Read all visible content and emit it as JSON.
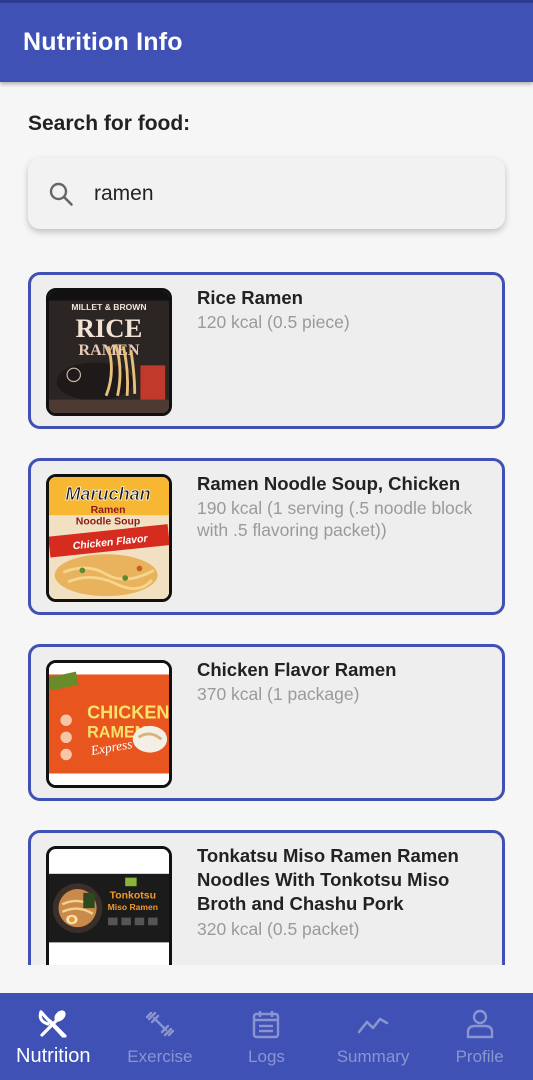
{
  "app_bar": {
    "title": "Nutrition Info"
  },
  "search": {
    "label": "Search for food:",
    "value": "ramen"
  },
  "results": [
    {
      "name": "Rice Ramen",
      "kcal": "120 kcal (0.5 piece)"
    },
    {
      "name": "Ramen Noodle Soup, Chicken",
      "kcal": "190 kcal (1 serving (.5 noodle block with .5 flavoring packet))"
    },
    {
      "name": "Chicken Flavor Ramen",
      "kcal": "370 kcal (1 package)"
    },
    {
      "name": "Tonkatsu Miso Ramen Ramen Noodles With Tonkotsu Miso Broth and Chashu Pork",
      "kcal": "320 kcal (0.5 packet)"
    }
  ],
  "thumb_text": {
    "rice": {
      "line1": "MILLET & BROWN",
      "line2": "RICE",
      "line3": "RAMEN"
    },
    "maruchan": {
      "brand": "Maruchan",
      "line1": "Ramen",
      "line2": "Noodle Soup",
      "flavor": "Chicken Flavor"
    },
    "chicken": {
      "line1": "CHICKEN",
      "line2": "RAMEN",
      "line3": "Express"
    },
    "tonkatsu": {
      "line1": "Tonkotsu",
      "line2": "Miso Ramen"
    }
  },
  "bottom_nav": {
    "active": "Nutrition",
    "items": [
      {
        "label": "Nutrition",
        "icon": "fork-knife-icon"
      },
      {
        "label": "Exercise",
        "icon": "dumbbell-icon"
      },
      {
        "label": "Logs",
        "icon": "calendar-icon"
      },
      {
        "label": "Summary",
        "icon": "trend-line-icon"
      },
      {
        "label": "Profile",
        "icon": "person-icon"
      }
    ]
  },
  "colors": {
    "primary": "#3f51b5",
    "inactive_nav": "#8a95d0",
    "card_bg": "#eeeeee",
    "secondary_text": "#9a9a9a"
  }
}
